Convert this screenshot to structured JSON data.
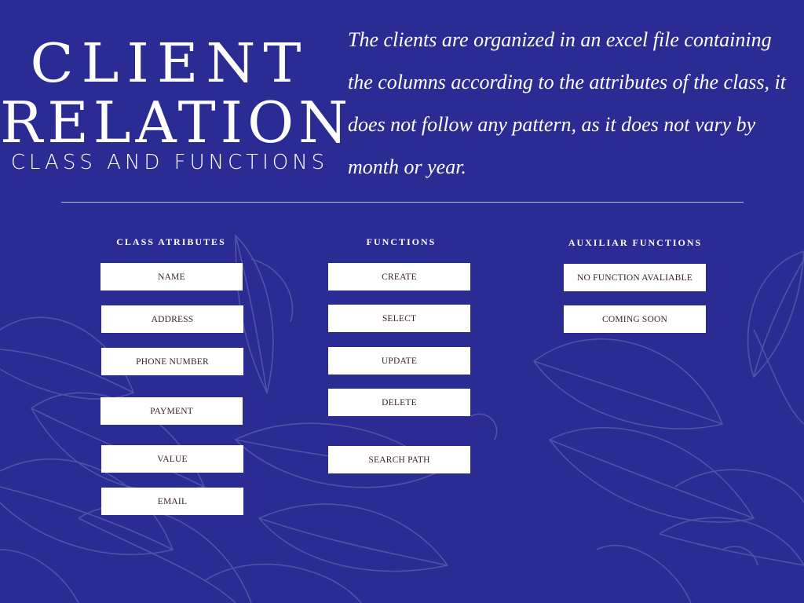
{
  "title": {
    "line1": "CLIENT",
    "line2": "RELATION",
    "subtitle": "CLASS AND FUNCTIONS"
  },
  "description": "The clients are organized in an excel file containing the columns according to the attributes of the class, it does not follow any pattern, as it does not vary by month or year.",
  "columns": {
    "attributes": {
      "header": "CLASS ATRIBUTES",
      "items": [
        "NAME",
        "ADDRESS",
        "PHONE NUMBER",
        "PAYMENT",
        "VALUE",
        "EMAIL"
      ]
    },
    "functions": {
      "header": "FUNCTIONS",
      "items": [
        "CREATE",
        "SELECT",
        "UPDATE",
        "DELETE",
        "SEARCH PATH"
      ]
    },
    "auxiliar": {
      "header": "AUXILIAR FUNCTIONS",
      "items": [
        "NO FUNCTION AVALIABLE",
        "COMING SOON"
      ]
    }
  },
  "colors": {
    "background": "#2a2b93",
    "box_background": "#ffffff",
    "box_text": "#3a2230",
    "decoration_lines": "#6a6ab0"
  }
}
